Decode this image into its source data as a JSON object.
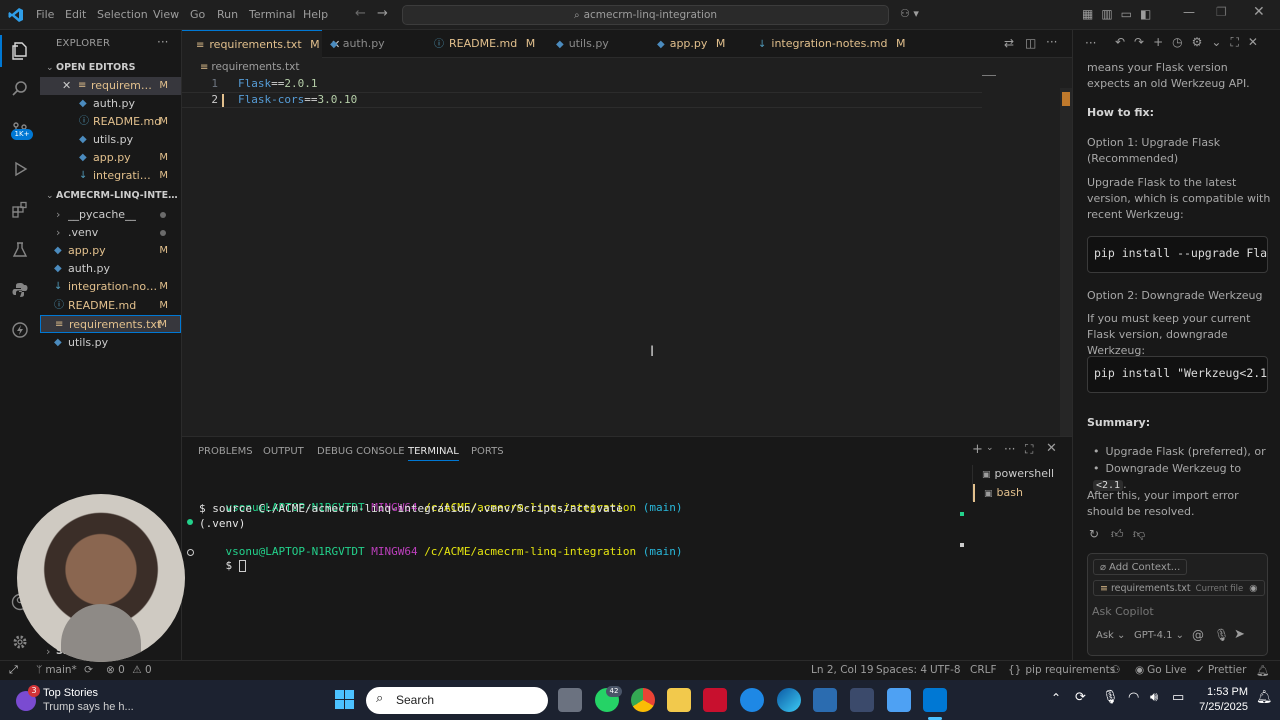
{
  "titlebar": {
    "menu": [
      "File",
      "Edit",
      "Selection",
      "View",
      "Go",
      "Run",
      "Terminal",
      "Help"
    ],
    "command_center": "acmecrm-linq-integration"
  },
  "activity": {
    "badge": "1K+"
  },
  "explorer": {
    "title": "EXPLORER",
    "open_editors_label": "OPEN EDITORS",
    "open_editors": [
      {
        "name": "requireme...",
        "status": "M"
      },
      {
        "name": "auth.py",
        "status": ""
      },
      {
        "name": "README.md",
        "status": "M"
      },
      {
        "name": "utils.py",
        "status": ""
      },
      {
        "name": "app.py",
        "status": "M"
      },
      {
        "name": "integration...",
        "status": "M"
      }
    ],
    "project_label": "ACMECRM-LINQ-INTEGRA...",
    "files": [
      {
        "name": "__pycache__",
        "status": ""
      },
      {
        "name": ".venv",
        "status": ""
      },
      {
        "name": "app.py",
        "status": "M"
      },
      {
        "name": "auth.py",
        "status": ""
      },
      {
        "name": "integration-not...",
        "status": "M"
      },
      {
        "name": "README.md",
        "status": "M"
      },
      {
        "name": "requirements.txt",
        "status": "M"
      },
      {
        "name": "utils.py",
        "status": ""
      }
    ],
    "bottom_label": "SE"
  },
  "tabs": [
    {
      "label": "requirements.txt",
      "status": "M"
    },
    {
      "label": "auth.py",
      "status": ""
    },
    {
      "label": "README.md",
      "status": "M"
    },
    {
      "label": "utils.py",
      "status": ""
    },
    {
      "label": "app.py",
      "status": "M"
    },
    {
      "label": "integration-notes.md",
      "status": "M"
    }
  ],
  "editor": {
    "breadcrumb": "requirements.txt",
    "lines": [
      {
        "num": "1",
        "pkg": "Flask",
        "op": "==",
        "ver": "2.0.1"
      },
      {
        "num": "2",
        "pkg": "Flask-cors",
        "op": "==",
        "ver": "3.0.10"
      }
    ]
  },
  "panel": {
    "tabs": [
      "PROBLEMS",
      "OUTPUT",
      "DEBUG CONSOLE",
      "TERMINAL",
      "PORTS"
    ],
    "terminal": {
      "user": "vsonu@LAPTOP-N1RGVTDT",
      "env": "MINGW64",
      "path": "/c/ACME/acmecrm-linq-integration",
      "branch": "(main)",
      "command": "$ source C:/ACME/acmecrm-linq-integration/.venv/Scripts/activate",
      "venv": "(.venv)",
      "prompt": "$"
    },
    "shells": [
      "powershell",
      "bash"
    ]
  },
  "copilot": {
    "intro": "means your Flask version expects an old Werkzeug API.",
    "how_to_fix": "How to fix:",
    "option1_title": "Option 1: Upgrade Flask (Recommended)",
    "option1_text": "Upgrade Flask to the latest version, which is compatible with recent Werkzeug:",
    "option1_code": "pip install --upgrade Flask",
    "option2_title": "Option 2: Downgrade Werkzeug",
    "option2_text": "If you must keep your current Flask version, downgrade Werkzeug:",
    "option2_code": "pip install \"Werkzeug<2.1\"",
    "summary_title": "Summary:",
    "summary_item1": "Upgrade Flask (preferred), or",
    "summary_item2_prefix": "Downgrade Werkzeug to",
    "summary_item2_code": "<2.1",
    "closing": "After this, your import error should be resolved.",
    "add_context": "Add Context...",
    "current_file_name": "requirements.txt",
    "current_file_tag": "Current file",
    "ask_placeholder": "Ask Copilot",
    "mode": "Ask",
    "model": "GPT-4.1"
  },
  "statusbar": {
    "branch": "main*",
    "errors": "0",
    "warnings": "0",
    "position": "Ln 2, Col 19",
    "spaces": "Spaces: 4",
    "encoding": "UTF-8",
    "eol": "CRLF",
    "language": "pip requirements",
    "golive": "Go Live",
    "prettier": "Prettier"
  },
  "taskbar": {
    "news_badge": "3",
    "news_title": "Top Stories",
    "news_sub": "Trump says he h...",
    "search": "Search",
    "whatsapp_badge": "42",
    "time": "1:53 PM",
    "date": "7/25/2025"
  },
  "colors": {
    "accent": "#0078d4",
    "modified": "#e2c08d",
    "keyword_blue": "#569cd6",
    "version_green": "#b5cea8",
    "terminal_green": "#23d18b",
    "terminal_path": "#e5e510"
  }
}
